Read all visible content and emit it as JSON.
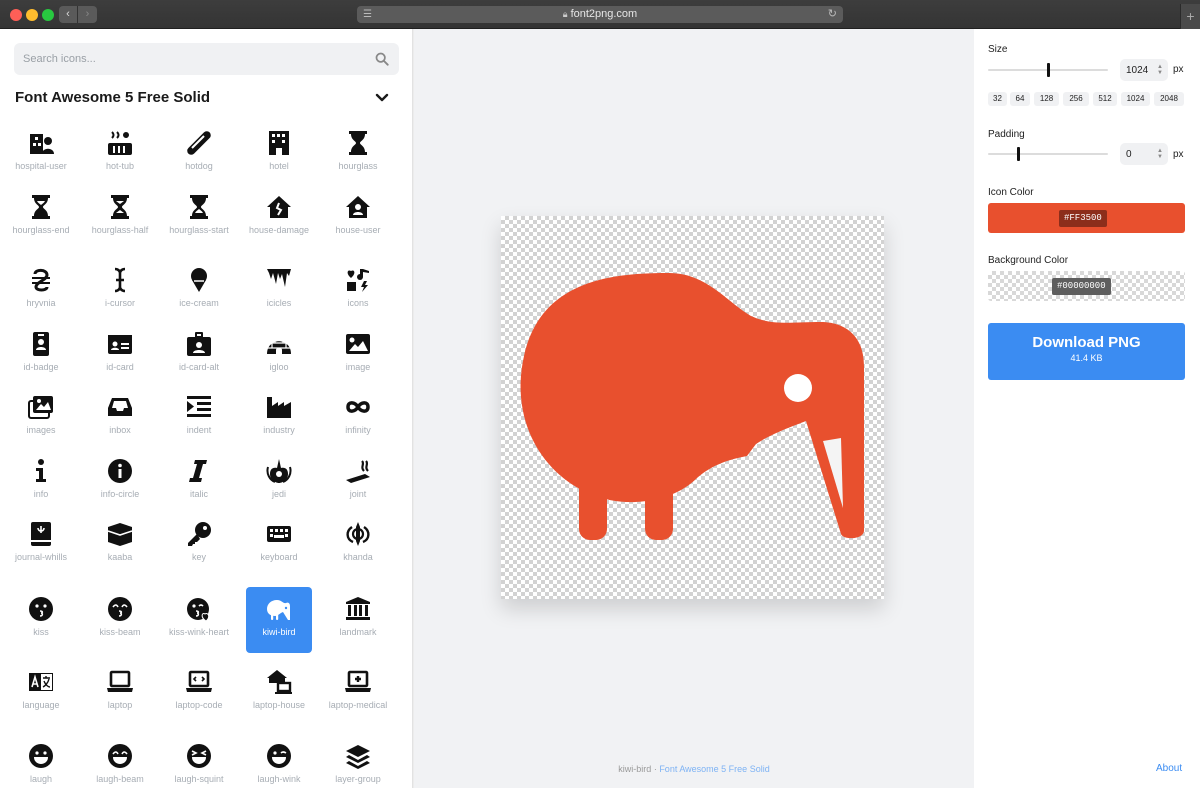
{
  "browser": {
    "url": "font2png.com",
    "back_glyph": "‹",
    "forward_glyph": "›",
    "new_tab_glyph": "+"
  },
  "search": {
    "placeholder": "Search icons..."
  },
  "collection": {
    "title": "Font Awesome 5 Free Solid"
  },
  "icons": [
    {
      "label": "hospital-user",
      "icon": "hospital-user-icon"
    },
    {
      "label": "hot-tub",
      "icon": "hot-tub-icon"
    },
    {
      "label": "hotdog",
      "icon": "hotdog-icon"
    },
    {
      "label": "hotel",
      "icon": "hotel-icon"
    },
    {
      "label": "hourglass",
      "icon": "hourglass-icon"
    },
    {
      "label": "hourglass-end",
      "icon": "hourglass-end-icon"
    },
    {
      "label": "hourglass-half",
      "icon": "hourglass-half-icon"
    },
    {
      "label": "hourglass-start",
      "icon": "hourglass-start-icon"
    },
    {
      "label": "house-damage",
      "icon": "house-damage-icon"
    },
    {
      "label": "house-user",
      "icon": "house-user-icon"
    },
    {
      "label": "hryvnia",
      "icon": "hryvnia-icon"
    },
    {
      "label": "i-cursor",
      "icon": "i-cursor-icon"
    },
    {
      "label": "ice-cream",
      "icon": "ice-cream-icon"
    },
    {
      "label": "icicles",
      "icon": "icicles-icon"
    },
    {
      "label": "icons",
      "icon": "icons-icon"
    },
    {
      "label": "id-badge",
      "icon": "id-badge-icon"
    },
    {
      "label": "id-card",
      "icon": "id-card-icon"
    },
    {
      "label": "id-card-alt",
      "icon": "id-card-alt-icon"
    },
    {
      "label": "igloo",
      "icon": "igloo-icon"
    },
    {
      "label": "image",
      "icon": "image-icon"
    },
    {
      "label": "images",
      "icon": "images-icon"
    },
    {
      "label": "inbox",
      "icon": "inbox-icon"
    },
    {
      "label": "indent",
      "icon": "indent-icon"
    },
    {
      "label": "industry",
      "icon": "industry-icon"
    },
    {
      "label": "infinity",
      "icon": "infinity-icon"
    },
    {
      "label": "info",
      "icon": "info-icon"
    },
    {
      "label": "info-circle",
      "icon": "info-circle-icon"
    },
    {
      "label": "italic",
      "icon": "italic-icon"
    },
    {
      "label": "jedi",
      "icon": "jedi-icon"
    },
    {
      "label": "joint",
      "icon": "joint-icon"
    },
    {
      "label": "journal-whills",
      "icon": "journal-whills-icon"
    },
    {
      "label": "kaaba",
      "icon": "kaaba-icon"
    },
    {
      "label": "key",
      "icon": "key-icon"
    },
    {
      "label": "keyboard",
      "icon": "keyboard-icon"
    },
    {
      "label": "khanda",
      "icon": "khanda-icon"
    },
    {
      "label": "kiss",
      "icon": "kiss-icon"
    },
    {
      "label": "kiss-beam",
      "icon": "kiss-beam-icon"
    },
    {
      "label": "kiss-wink-heart",
      "icon": "kiss-wink-heart-icon"
    },
    {
      "label": "kiwi-bird",
      "icon": "kiwi-bird-icon",
      "selected": true
    },
    {
      "label": "landmark",
      "icon": "landmark-icon"
    },
    {
      "label": "language",
      "icon": "language-icon"
    },
    {
      "label": "laptop",
      "icon": "laptop-icon"
    },
    {
      "label": "laptop-code",
      "icon": "laptop-code-icon"
    },
    {
      "label": "laptop-house",
      "icon": "laptop-house-icon"
    },
    {
      "label": "laptop-medical",
      "icon": "laptop-medical-icon"
    },
    {
      "label": "laugh",
      "icon": "laugh-icon"
    },
    {
      "label": "laugh-beam",
      "icon": "laugh-beam-icon"
    },
    {
      "label": "laugh-squint",
      "icon": "laugh-squint-icon"
    },
    {
      "label": "laugh-wink",
      "icon": "laugh-wink-icon"
    },
    {
      "label": "layer-group",
      "icon": "layer-group-icon"
    }
  ],
  "preview": {
    "icon_name": "kiwi-bird",
    "separator": " · ",
    "collection_link": "Font Awesome 5 Free Solid"
  },
  "settings": {
    "size": {
      "label": "Size",
      "value": "1024",
      "unit": "px",
      "slider_fraction": 0.5,
      "presets": [
        "32",
        "64",
        "128",
        "256",
        "512",
        "1024",
        "2048"
      ]
    },
    "padding": {
      "label": "Padding",
      "value": "0",
      "unit": "px",
      "slider_fraction": 0.25
    },
    "icon_color": {
      "label": "Icon Color",
      "hex": "#FF3500"
    },
    "background_color": {
      "label": "Background Color",
      "hex": "#00000000"
    },
    "download": {
      "label": "Download PNG",
      "size": "41.4 KB"
    }
  },
  "footer": {
    "about": "About"
  },
  "colors": {
    "accent": "#3b8cf2",
    "icon_render": "#e8502e"
  }
}
